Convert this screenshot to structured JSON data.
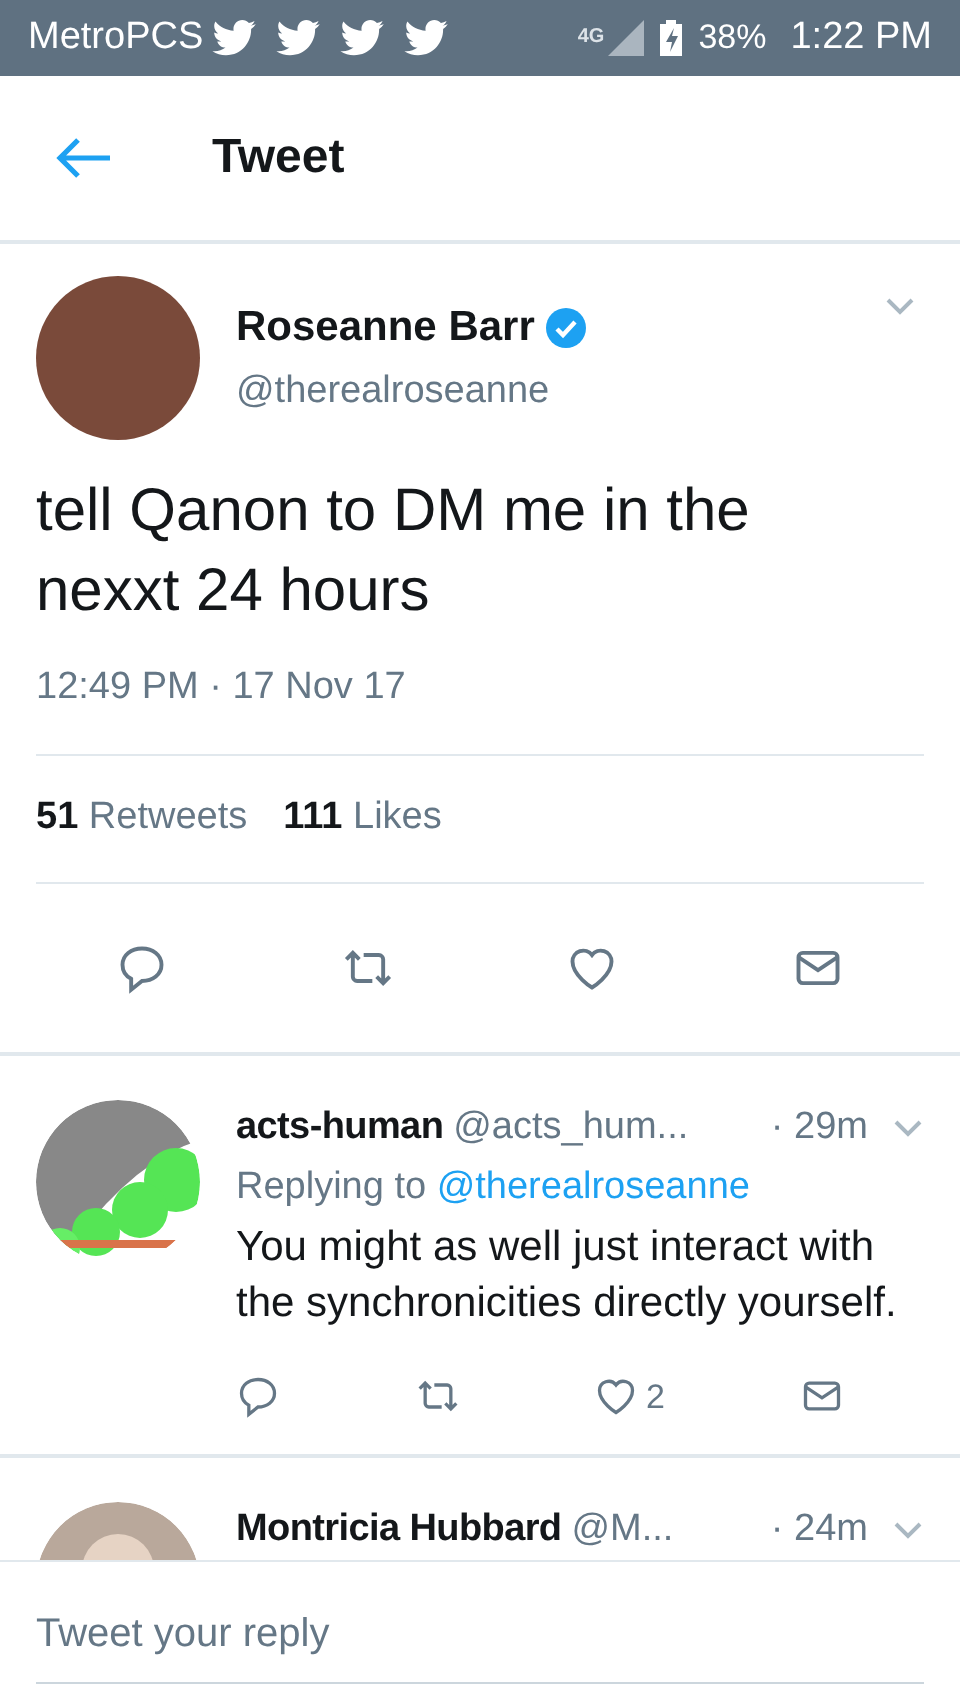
{
  "status_bar": {
    "carrier": "MetroPCS",
    "network": "4G",
    "battery": "38%",
    "time": "1:22 PM"
  },
  "header": {
    "title": "Tweet"
  },
  "tweet": {
    "name": "Roseanne Barr",
    "verified": true,
    "handle": "@therealroseanne",
    "text": "tell Qanon to DM me in the nexxt 24 hours",
    "timestamp": "12:49 PM · 17 Nov 17",
    "stats": [
      {
        "count": "51",
        "label": "Retweets"
      },
      {
        "count": "111",
        "label": "Likes"
      }
    ]
  },
  "replies": [
    {
      "name": "acts-human",
      "handle": "@acts_hum...",
      "time": "· 29m",
      "replying_label": "Replying to",
      "replying_to": "@therealroseanne",
      "text": "You might as well just interact with the synchronicities directly yourself.",
      "likes": "2",
      "kind": "picture"
    },
    {
      "name": "Montricia Hubbard",
      "handle": "@M...",
      "time": "· 24m",
      "kind": "figure"
    }
  ],
  "reply_box": {
    "placeholder": "Tweet your reply"
  }
}
